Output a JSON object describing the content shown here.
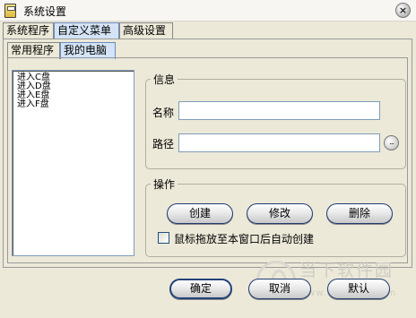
{
  "window": {
    "title": "系统设置"
  },
  "tabs": [
    {
      "label": "系统程序"
    },
    {
      "label": "自定义菜单"
    },
    {
      "label": "高级设置"
    }
  ],
  "subtabs": [
    {
      "label": "常用程序"
    },
    {
      "label": "我的电脑"
    }
  ],
  "list": {
    "items": [
      "进入C盘",
      "进入D盘",
      "进入E盘",
      "进入F盘"
    ]
  },
  "info": {
    "title": "信息",
    "name_label": "名称",
    "name_value": "",
    "path_label": "路径",
    "path_value": "",
    "browse_label": "..."
  },
  "ops": {
    "title": "操作",
    "create": "创建",
    "modify": "修改",
    "delete": "删除",
    "auto_create_label": "鼠标拖放至本窗口后自动创建",
    "auto_create_checked": false
  },
  "footer": {
    "ok": "确定",
    "cancel": "取消",
    "default": "默认"
  },
  "watermark": {
    "text": "当下软件园",
    "url": "www.downxia.com"
  }
}
